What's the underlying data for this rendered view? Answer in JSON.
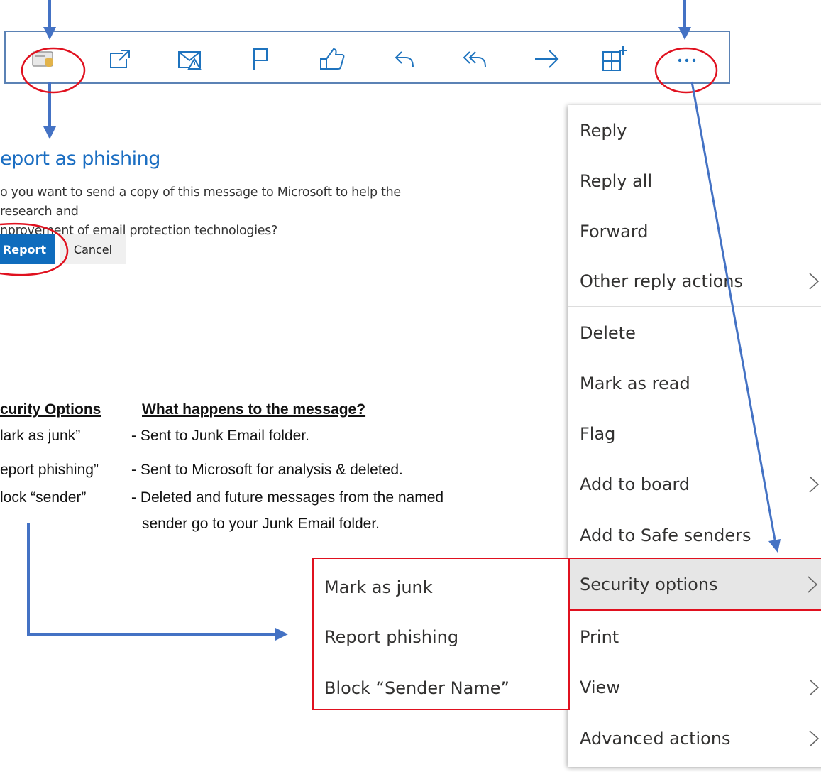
{
  "toolbar": {
    "icons": [
      "security-shield-mail-icon",
      "open-in-new-window-icon",
      "report-junk-mail-icon",
      "flag-icon",
      "like-thumbs-up-icon",
      "reply-icon",
      "reply-all-icon",
      "forward-icon",
      "add-to-board-icon",
      "more-actions-icon"
    ]
  },
  "report_dialog": {
    "title": "eport as phishing",
    "description_line1": "o you want to send a copy of this message to Microsoft to help the research and",
    "description_line2": "nprovement of email protection technologies?",
    "report_label": "Report",
    "cancel_label": "Cancel"
  },
  "info_table": {
    "header_option": "curity Options",
    "header_result": "What happens to the message?",
    "rows": [
      {
        "option": "lark as junk”",
        "result": "- Sent to Junk Email folder."
      },
      {
        "option": "eport phishing”",
        "result": "- Sent to Microsoft for analysis & deleted."
      },
      {
        "option": "lock “sender”",
        "result": "- Deleted and future messages from the named"
      }
    ],
    "continuation": "sender go to your Junk Email folder."
  },
  "context_menu": {
    "items": [
      {
        "label": "Reply"
      },
      {
        "label": "Reply all"
      },
      {
        "label": "Forward"
      },
      {
        "label": "Other reply actions"
      },
      {
        "label": "Delete"
      },
      {
        "label": "Mark as read"
      },
      {
        "label": "Flag"
      },
      {
        "label": "Add to board"
      },
      {
        "label": "Add to Safe senders"
      },
      {
        "label": "Security options"
      },
      {
        "label": "Print"
      },
      {
        "label": "View"
      },
      {
        "label": "Advanced actions"
      }
    ]
  },
  "security_submenu": {
    "items": [
      {
        "label": "Mark as junk"
      },
      {
        "label": "Report phishing"
      },
      {
        "label": "Block “Sender Name”"
      }
    ]
  },
  "colors": {
    "accent_blue": "#0f6cbd",
    "annotation_blue": "#4472c4",
    "annotation_red": "#e0111f",
    "menu_highlight": "#e6e6e6"
  }
}
